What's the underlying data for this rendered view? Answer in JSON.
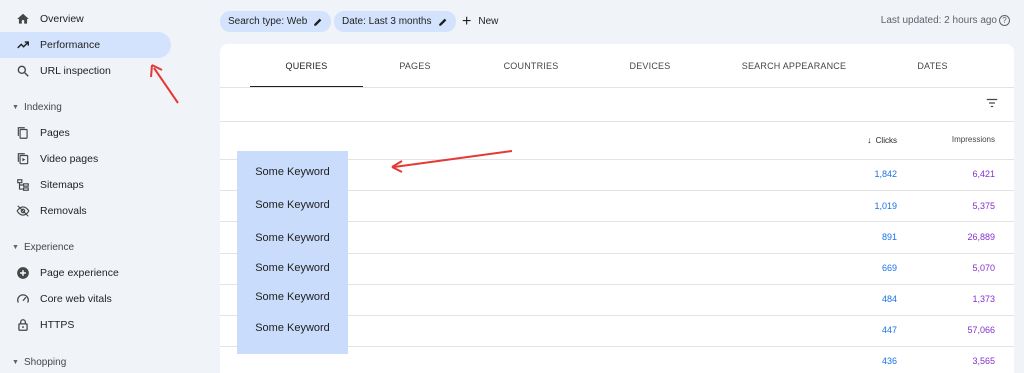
{
  "sidebar": {
    "items": [
      {
        "label": "Overview",
        "icon": "home-icon"
      },
      {
        "label": "Performance",
        "icon": "trending-up-icon",
        "active": true
      },
      {
        "label": "URL inspection",
        "icon": "search-icon"
      }
    ],
    "sections": [
      {
        "label": "Indexing",
        "items": [
          {
            "label": "Pages",
            "icon": "pages-icon"
          },
          {
            "label": "Video pages",
            "icon": "video-pages-icon"
          },
          {
            "label": "Sitemaps",
            "icon": "sitemap-icon"
          },
          {
            "label": "Removals",
            "icon": "eye-off-icon"
          }
        ]
      },
      {
        "label": "Experience",
        "items": [
          {
            "label": "Page experience",
            "icon": "plus-circle-icon"
          },
          {
            "label": "Core web vitals",
            "icon": "gauge-icon"
          },
          {
            "label": "HTTPS",
            "icon": "lock-icon"
          }
        ]
      },
      {
        "label": "Shopping",
        "items": []
      }
    ]
  },
  "toolbar": {
    "search_type": "Search type: Web",
    "date": "Date: Last 3 months",
    "new_label": "New",
    "last_updated": "Last updated: 2 hours ago"
  },
  "tabs": [
    "QUERIES",
    "PAGES",
    "COUNTRIES",
    "DEVICES",
    "SEARCH APPEARANCE",
    "DATES"
  ],
  "table": {
    "columns": {
      "clicks": "Clicks",
      "impressions": "Impressions"
    },
    "rows": [
      {
        "keyword": "Some Keyword",
        "clicks": "1,842",
        "impressions": "6,421"
      },
      {
        "keyword": "Some Keyword",
        "clicks": "1,019",
        "impressions": "5,375"
      },
      {
        "keyword": "Some Keyword",
        "clicks": "891",
        "impressions": "26,889"
      },
      {
        "keyword": "Some Keyword",
        "clicks": "669",
        "impressions": "5,070"
      },
      {
        "keyword": "Some Keyword",
        "clicks": "484",
        "impressions": "1,373"
      },
      {
        "keyword": "Some Keyword",
        "clicks": "447",
        "impressions": "57,066"
      },
      {
        "keyword": "",
        "clicks": "436",
        "impressions": "3,565"
      }
    ]
  },
  "colors": {
    "accent": "#1a73e8",
    "impressions": "#8430ce",
    "active_bg": "#d3e3fd",
    "annotation": "#e53935"
  }
}
